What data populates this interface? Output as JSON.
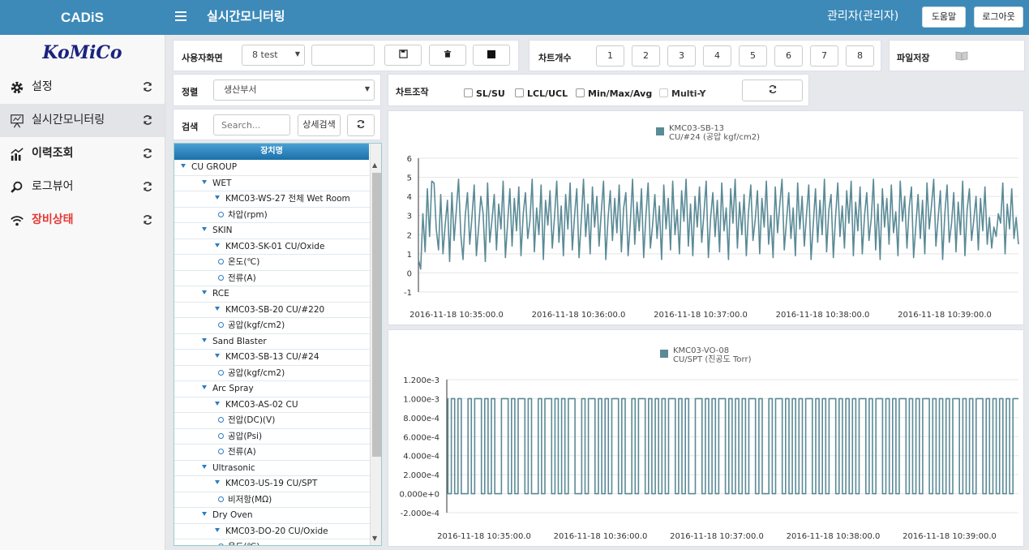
{
  "header": {
    "brand": "CADiS",
    "title": "실시간모니터링",
    "user": "관리자(관리자)",
    "help_label": "도움말",
    "logout_label": "로그아웃"
  },
  "sidebar": {
    "logo": "KoMiCo",
    "items": [
      {
        "label": "설정",
        "icon": "gear-icon"
      },
      {
        "label": "실시간모니터링",
        "icon": "presentation-board-icon"
      },
      {
        "label": "이력조회",
        "icon": "bar-chart-icon"
      },
      {
        "label": "로그뷰어",
        "icon": "magnifier-icon"
      },
      {
        "label": "장비상태",
        "icon": "wifi-icon",
        "color": "#e53935"
      }
    ]
  },
  "toolbar": {
    "screen_label": "사용자화면",
    "screen_value": "8 test",
    "screen_name_value": "",
    "chart_count_label": "차트개수",
    "chart_counts": [
      "1",
      "2",
      "3",
      "4",
      "5",
      "6",
      "7",
      "8"
    ],
    "file_save_label": "파일저장"
  },
  "filters": {
    "sort_label": "정렬",
    "sort_value": "생산부서",
    "search_label": "검색",
    "search_placeholder": "Search...",
    "detail_search_label": "상세검색"
  },
  "chart_controls": {
    "label": "차트조작",
    "options": [
      "SL/SU",
      "LCL/UCL",
      "Min/Max/Avg",
      "Multi-Y"
    ]
  },
  "tree": {
    "header": "장치명",
    "rows": [
      {
        "level": 0,
        "type": "group",
        "label": "CU GROUP"
      },
      {
        "level": 1,
        "type": "group",
        "label": "WET"
      },
      {
        "level": 2,
        "type": "group",
        "label": "KMC03-WS-27 전체 Wet Room"
      },
      {
        "level": 3,
        "type": "leaf",
        "label": "차압(rpm)"
      },
      {
        "level": 1,
        "type": "group",
        "label": "SKIN"
      },
      {
        "level": 2,
        "type": "group",
        "label": "KMC03-SK-01 CU/Oxide"
      },
      {
        "level": 3,
        "type": "leaf",
        "label": "온도(℃)"
      },
      {
        "level": 3,
        "type": "leaf",
        "label": "전류(A)"
      },
      {
        "level": 1,
        "type": "group",
        "label": "RCE"
      },
      {
        "level": 2,
        "type": "group",
        "label": "KMC03-SB-20 CU/#220"
      },
      {
        "level": 3,
        "type": "leaf",
        "label": "공압(kgf/cm2)"
      },
      {
        "level": 1,
        "type": "group",
        "label": "Sand Blaster"
      },
      {
        "level": 2,
        "type": "group",
        "label": "KMC03-SB-13 CU/#24"
      },
      {
        "level": 3,
        "type": "leaf",
        "label": "공압(kgf/cm2)"
      },
      {
        "level": 1,
        "type": "group",
        "label": "Arc Spray"
      },
      {
        "level": 2,
        "type": "group",
        "label": "KMC03-AS-02 CU"
      },
      {
        "level": 3,
        "type": "leaf",
        "label": "전압(DC)(V)"
      },
      {
        "level": 3,
        "type": "leaf",
        "label": "공압(Psi)"
      },
      {
        "level": 3,
        "type": "leaf",
        "label": "전류(A)"
      },
      {
        "level": 1,
        "type": "group",
        "label": "Ultrasonic"
      },
      {
        "level": 2,
        "type": "group",
        "label": "KMC03-US-19 CU/SPT"
      },
      {
        "level": 3,
        "type": "leaf",
        "label": "비저항(MΩ)"
      },
      {
        "level": 1,
        "type": "group",
        "label": "Dry Oven"
      },
      {
        "level": 2,
        "type": "group",
        "label": "KMC03-DO-20 CU/Oxide"
      },
      {
        "level": 3,
        "type": "leaf",
        "label": "온도(℃)"
      }
    ]
  },
  "colors": {
    "header": "#3d8ab9",
    "series": "#5a8a96",
    "alert": "#e53935"
  },
  "chart_data": [
    {
      "type": "line",
      "legend": [
        "KMC03-SB-13",
        "CU/#24 (공압 kgf/cm2)"
      ],
      "ylim": [
        -1,
        6
      ],
      "yticks": [
        "-1",
        "0",
        "1",
        "2",
        "3",
        "4",
        "5",
        "6"
      ],
      "xticks": [
        "2016-11-18 10:35:00.0",
        "2016-11-18 10:36:00.0",
        "2016-11-18 10:37:00.0",
        "2016-11-18 10:38:00.0",
        "2016-11-18 10:39:00.0"
      ],
      "series": [
        {
          "values": [
            0.7,
            0.2,
            3.1,
            1.1,
            4.4,
            1.9,
            4.8,
            4.7,
            2.3,
            1.2,
            4.1,
            1.0,
            2.5,
            3.8,
            0.6,
            4.2,
            1.7,
            3.3,
            4.9,
            2.0,
            0.7,
            3.0,
            4.2,
            1.5,
            2.9,
            4.6,
            0.9,
            2.4,
            4.0,
            3.1,
            0.6,
            4.7,
            1.6,
            2.8,
            4.1,
            1.2,
            3.6,
            2.3,
            4.8,
            0.8,
            2.6,
            4.4,
            1.4,
            3.9,
            2.2,
            4.5,
            0.9,
            3.1,
            4.2,
            1.8,
            2.7,
            4.9,
            1.1,
            3.4,
            2.0,
            4.6,
            0.7,
            3.8,
            2.5,
            4.3,
            1.3,
            2.9,
            4.8,
            1.6,
            3.5,
            0.9,
            4.1,
            2.3,
            4.7,
            1.2,
            3.0,
            4.4,
            0.8,
            2.7,
            4.9,
            1.9,
            3.6,
            1.0,
            4.5,
            2.4,
            4.0,
            1.4,
            3.2,
            4.8,
            0.7,
            2.8,
            4.3,
            1.7,
            3.9,
            2.1,
            4.6,
            1.1,
            3.4,
            4.2,
            0.9,
            2.6,
            4.9,
            1.5,
            3.7,
            2.2,
            4.4,
            0.8,
            3.0,
            4.7,
            1.3,
            2.5,
            4.1,
            1.8,
            3.5,
            0.7,
            4.6,
            2.3,
            3.9,
            1.2,
            4.8,
            2.0,
            3.3,
            1.0,
            4.3,
            2.7,
            4.9,
            1.4,
            3.6,
            0.9,
            4.0,
            2.4,
            4.5,
            1.6,
            3.1,
            4.8,
            0.8,
            2.9,
            4.2,
            1.9,
            3.8,
            1.1,
            4.7,
            2.2,
            3.4,
            0.7,
            4.4,
            2.6,
            4.9,
            1.3,
            3.7,
            2.0,
            4.1,
            0.9,
            3.2,
            4.6,
            1.7,
            2.8,
            4.3,
            1.0,
            3.9,
            2.4,
            4.8,
            1.5,
            3.0,
            0.8,
            4.5,
            2.1,
            3.6,
            4.9,
            1.2,
            2.7,
            4.2,
            1.8,
            3.4,
            0.9,
            4.7,
            2.3,
            4.0,
            1.4,
            3.1,
            4.6,
            0.7,
            2.5,
            4.4,
            1.6,
            3.8,
            2.0,
            4.9,
            1.1,
            3.3,
            4.1,
            0.8,
            2.9,
            4.7,
            1.9,
            3.5,
            1.3,
            4.3,
            2.6,
            4.8,
            0.9,
            3.7,
            2.2,
            4.5,
            1.0,
            3.0,
            4.2,
            1.7,
            2.8,
            4.9,
            1.2,
            3.6,
            0.7,
            4.4,
            2.4,
            3.9,
            1.5,
            4.6,
            2.1,
            3.2,
            0.9,
            4.8,
            2.7,
            4.0,
            1.3,
            3.4,
            4.5,
            0.8,
            2.5,
            4.1,
            1.8,
            3.8,
            1.0,
            4.7,
            2.3,
            3.5,
            4.9,
            1.4,
            2.9,
            4.3,
            0.7,
            3.1,
            4.6,
            1.6,
            2.6,
            4.2,
            1.1,
            3.7,
            2.0,
            4.8,
            0.9,
            3.3,
            4.4,
            1.7,
            2.8,
            4.0,
            1.2,
            3.9,
            2.2,
            4.5,
            1.5,
            2.9,
            1.3,
            2.4,
            1.9,
            3.1,
            2.6,
            4.7,
            1.0,
            3.6,
            2.3,
            4.4,
            1.8,
            2.9,
            1.5
          ]
        }
      ]
    },
    {
      "type": "line",
      "step": true,
      "legend": [
        "KMC03-VO-08",
        "CU/SPT (진공도 Torr)"
      ],
      "ylim": [
        -0.0002,
        0.0012
      ],
      "yticks": [
        "-2.000e-4",
        "0.000e+0",
        "2.000e-4",
        "4.000e-4",
        "6.000e-4",
        "8.000e-4",
        "1.000e-3",
        "1.200e-3"
      ],
      "xticks": [
        "2016-11-18 10:35:00.0",
        "2016-11-18 10:36:00.0",
        "2016-11-18 10:37:00.0",
        "2016-11-18 10:38:00.0",
        "2016-11-18 10:39:00.0"
      ],
      "series": [
        {
          "values": [
            0.001,
            0,
            0.001,
            0,
            0.001,
            0,
            0,
            0.001,
            0,
            0.001,
            0.001,
            0,
            0.001,
            0,
            0.001,
            0,
            0,
            0.001,
            0.001,
            0,
            0.001,
            0,
            0.001,
            0.001,
            0,
            0.001,
            0,
            0,
            0.001,
            0,
            0.001,
            0.001,
            0,
            0.001,
            0,
            0.001,
            0,
            0.001,
            0.001,
            0,
            0,
            0.001,
            0,
            0.001,
            0.001,
            0,
            0.001,
            0,
            0.001,
            0,
            0.001,
            0.001,
            0,
            0.001,
            0,
            0,
            0.001,
            0,
            0.001,
            0.001,
            0,
            0.001,
            0,
            0.001,
            0,
            0.001,
            0,
            0.001,
            0.001,
            0,
            0.001,
            0,
            0.001,
            0,
            0,
            0.001,
            0.001,
            0,
            0.001,
            0,
            0.001,
            0,
            0.001,
            0.001,
            0,
            0.001,
            0,
            0.001,
            0,
            0.001,
            0,
            0.001,
            0.001,
            0,
            0.001,
            0,
            0,
            0.001,
            0,
            0.001,
            0.001,
            0,
            0.001,
            0,
            0.001,
            0,
            0.001,
            0,
            0.001,
            0.001,
            0,
            0.001,
            0,
            0.001,
            0,
            0.001,
            0.001,
            0,
            0.001,
            0,
            0.001,
            0,
            0.001,
            0,
            0.001,
            0.001,
            0,
            0.001,
            0,
            0.001,
            0.001,
            0,
            0.001,
            0,
            0.001,
            0,
            0.001,
            0.001,
            0,
            0.001,
            0,
            0.001,
            0,
            0.001,
            0.001,
            0,
            0.001,
            0,
            0.001,
            0,
            0.001,
            0,
            0.001,
            0.001,
            0,
            0.001,
            0,
            0.001,
            0,
            0.001,
            0.001,
            0,
            0.001,
            0,
            0.001,
            0,
            0.001,
            0,
            0.001,
            0,
            0.001,
            0.001
          ]
        }
      ]
    }
  ]
}
